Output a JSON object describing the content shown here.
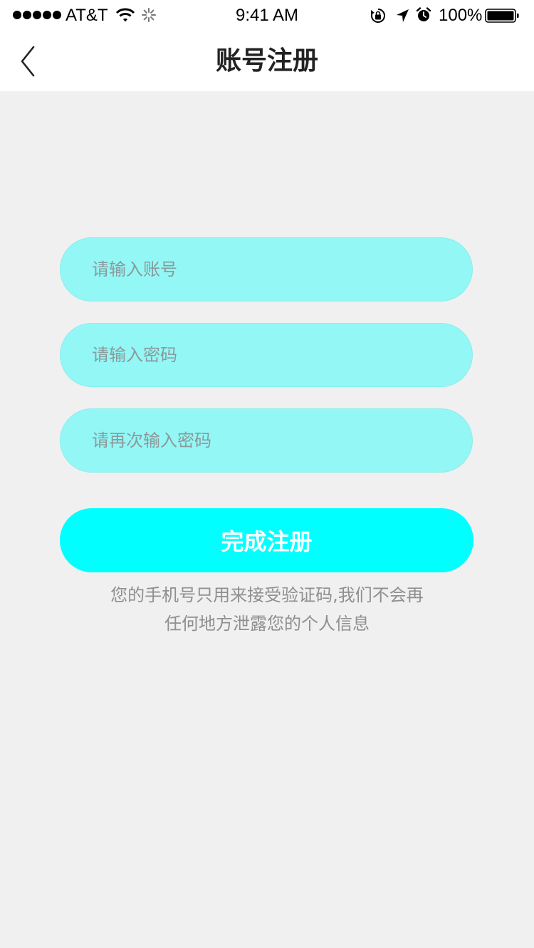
{
  "status_bar": {
    "carrier": "AT&T",
    "time": "9:41 AM",
    "battery": "100%"
  },
  "nav": {
    "title": "账号注册",
    "back_icon": "chevron-left-icon"
  },
  "form": {
    "account_placeholder": "请输入账号",
    "password_placeholder": "请输入密码",
    "confirm_placeholder": "请再次输入密码",
    "submit_label": "完成注册"
  },
  "notice": {
    "line1": "您的手机号只用来接受验证码,我们不会再",
    "line2": "任何地方泄露您的个人信息"
  },
  "colors": {
    "background": "#f0f0f0",
    "input_fill": "#93f7f6",
    "button_fill": "#00ffff",
    "button_text": "#ffffff",
    "hint_text": "#8f8f8f"
  }
}
